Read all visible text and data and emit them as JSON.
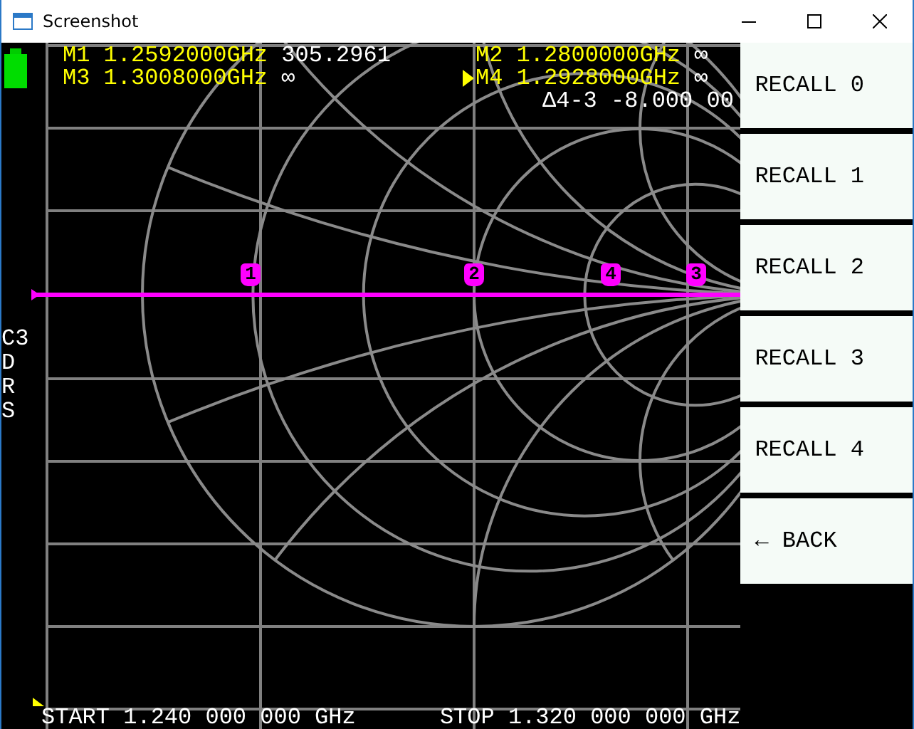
{
  "window": {
    "title": "Screenshot"
  },
  "markers": [
    {
      "label": "M1",
      "frequency": "1.2592000GHz",
      "value": "305.2961",
      "selected": false
    },
    {
      "label": "M2",
      "frequency": "1.2800000GHz",
      "value": "∞",
      "selected": false
    },
    {
      "label": "M3",
      "frequency": "1.3008000GHz",
      "value": "∞",
      "selected": false
    },
    {
      "label": "M4",
      "frequency": "1.2928000GHz",
      "value": "∞",
      "selected": true
    }
  ],
  "delta": "Δ4-3 -8.000 00",
  "trace_markers": [
    {
      "label": "1"
    },
    {
      "label": "2"
    },
    {
      "label": "4"
    },
    {
      "label": "3"
    }
  ],
  "channel_labels": [
    "C3",
    "D",
    "R",
    "S"
  ],
  "start": "START 1.240 000 000 GHz",
  "stop": "STOP 1.320 000 000 GHz",
  "menu": [
    {
      "label": "RECALL 0"
    },
    {
      "label": "RECALL 1"
    },
    {
      "label": "RECALL 2"
    },
    {
      "label": "RECALL 3"
    },
    {
      "label": "RECALL 4"
    },
    {
      "label": "← BACK"
    }
  ]
}
